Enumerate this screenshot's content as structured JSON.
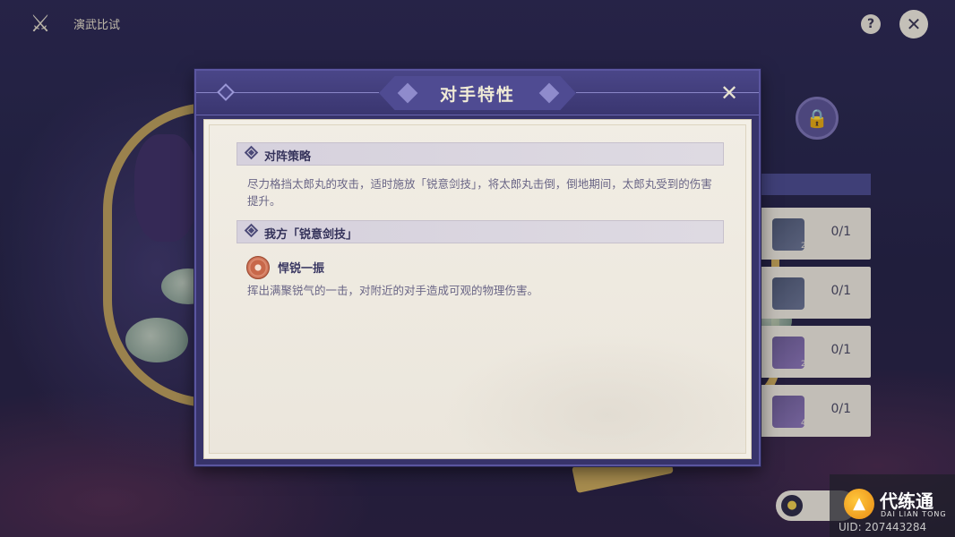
{
  "topbar": {
    "title": "演武比试"
  },
  "modal": {
    "title": "对手特性",
    "sections": [
      {
        "title": "对阵策略",
        "text": "尽力格挡太郎丸的攻击，适时施放「锐意剑技」，将太郎丸击倒，倒地期间，太郎丸受到的伤害提升。"
      },
      {
        "title": "我方「锐意剑技」",
        "skill": {
          "name": "悍锐一振",
          "icon": "skill-slash-icon",
          "description": "挥出满聚锐气的一击，对附近的对手造成可观的物理伤害。"
        }
      }
    ]
  },
  "rewards": [
    {
      "count": "2",
      "progress": "0/1"
    },
    {
      "count": "",
      "progress": "0/1"
    },
    {
      "count": "2",
      "progress": "0/1"
    },
    {
      "count": "4",
      "progress": "0/1"
    }
  ],
  "watermark": {
    "name": "代练通",
    "pinyin": "DAI LIAN TONG",
    "uid": "UID: 207443284"
  },
  "icons": {
    "back": "crossed-swords-icon",
    "help": "question-icon",
    "close": "close-icon",
    "lock": "lock-icon",
    "location": "location-pin-icon"
  },
  "colors": {
    "modal_frame": "#37336a",
    "modal_body": "#efebe2",
    "title_text": "#f1ecd6",
    "section_text": "#34325a"
  }
}
